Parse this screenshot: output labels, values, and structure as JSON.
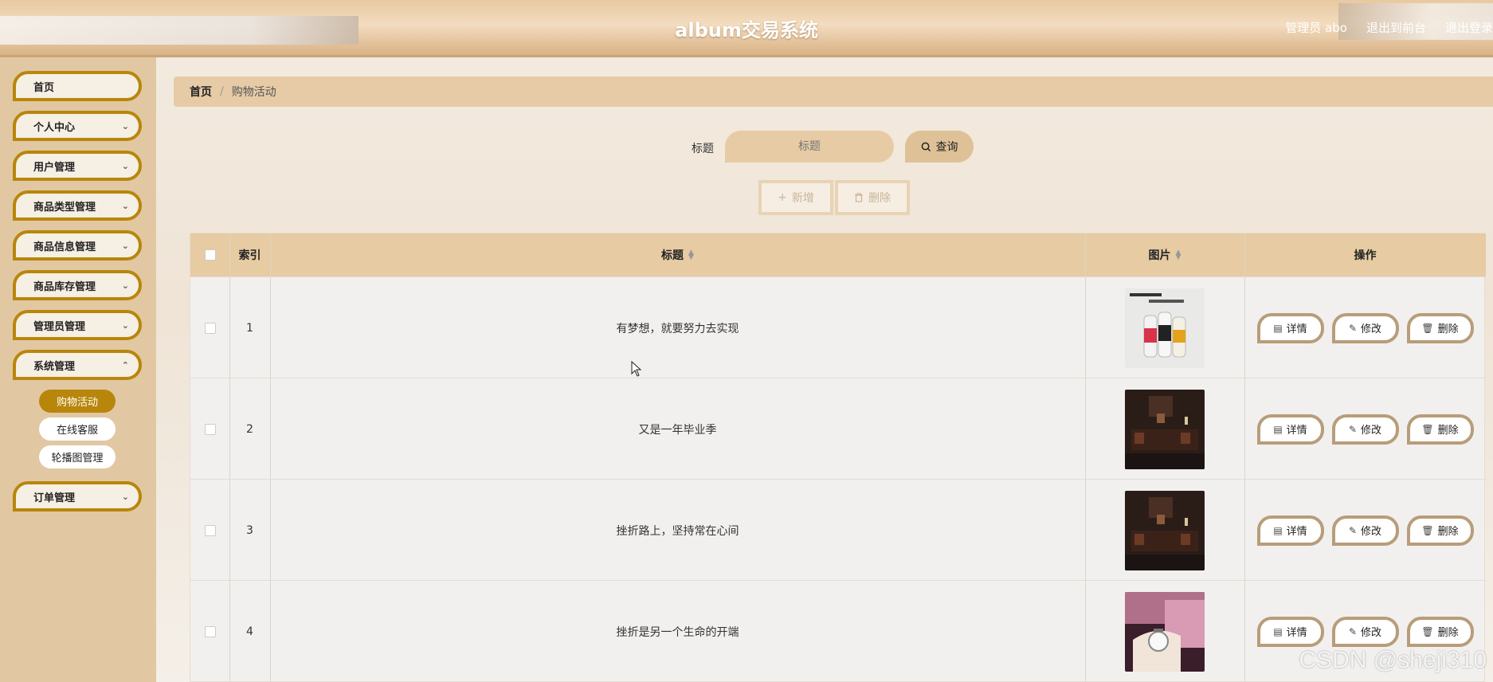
{
  "header": {
    "app_title": "album交易系统",
    "admin_label": "管理员 abo",
    "back_to_front": "退出到前台",
    "logout": "退出登录"
  },
  "sidebar": {
    "items": [
      {
        "label": "首页",
        "has_chevron": false
      },
      {
        "label": "个人中心",
        "has_chevron": true
      },
      {
        "label": "用户管理",
        "has_chevron": true
      },
      {
        "label": "商品类型管理",
        "has_chevron": true
      },
      {
        "label": "商品信息管理",
        "has_chevron": true
      },
      {
        "label": "商品库存管理",
        "has_chevron": true
      },
      {
        "label": "管理员管理",
        "has_chevron": true
      },
      {
        "label": "系统管理",
        "has_chevron": true
      },
      {
        "label": "订单管理",
        "has_chevron": true
      }
    ],
    "sub_items": [
      {
        "label": "购物活动",
        "active": true
      },
      {
        "label": "在线客服",
        "active": false
      },
      {
        "label": "轮播图管理",
        "active": false
      }
    ]
  },
  "breadcrumb": {
    "home": "首页",
    "sep": "/",
    "current": "购物活动"
  },
  "search": {
    "label": "标题",
    "placeholder": "标题",
    "button": "查询"
  },
  "actions": {
    "add": "新增",
    "delete": "删除"
  },
  "table": {
    "headers": {
      "index": "索引",
      "title": "标题",
      "image": "图片",
      "ops": "操作"
    },
    "rows": [
      {
        "index": "1",
        "title": "有梦想，就要努力去实现",
        "image": "drink-bottles"
      },
      {
        "index": "2",
        "title": "又是一年毕业季",
        "image": "dark-room"
      },
      {
        "index": "3",
        "title": "挫折路上，坚持常在心间",
        "image": "dark-room"
      },
      {
        "index": "4",
        "title": "挫折是另一个生命的开端",
        "image": "wrist-watch"
      }
    ],
    "op_labels": {
      "detail": "详情",
      "edit": "修改",
      "delete": "删除"
    }
  },
  "watermark": "CSDN @sheji310",
  "colors": {
    "accent": "#b8860b",
    "header_bg": "#e6cba6",
    "sidebar_bg": "#e1c8a3"
  }
}
